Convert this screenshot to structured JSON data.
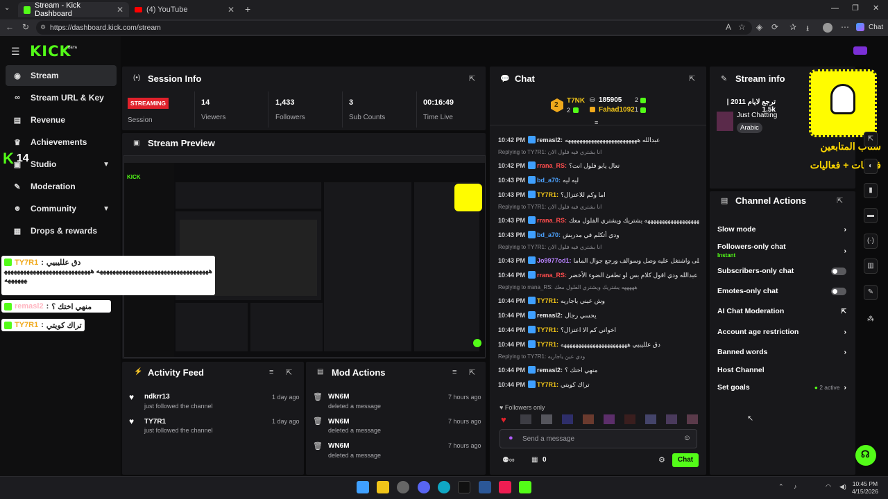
{
  "browser": {
    "tabs": [
      {
        "label": "Stream - Kick Dashboard"
      },
      {
        "label": "(4) YouTube"
      }
    ],
    "url": "https://dashboard.kick.com/stream",
    "chat_btn": "Chat"
  },
  "brand": {
    "logo": "KICK",
    "beta": "BETA",
    "accent": "#53fc18"
  },
  "sidebar": {
    "items": [
      {
        "label": "Stream",
        "icon": "broadcast-icon"
      },
      {
        "label": "Stream URL & Key",
        "icon": "link-icon"
      },
      {
        "label": "Revenue",
        "icon": "cash-icon"
      },
      {
        "label": "Achievements",
        "icon": "trophy-icon"
      },
      {
        "label": "Studio",
        "icon": "camera-icon"
      },
      {
        "label": "Moderation",
        "icon": "wrench-icon"
      },
      {
        "label": "Community",
        "icon": "people-icon"
      },
      {
        "label": "Drops & rewards",
        "icon": "gift-icon"
      }
    ],
    "overlay_count": "14"
  },
  "session": {
    "title": "Session Info",
    "status": "STREAMING",
    "status_label": "Session",
    "stats": [
      {
        "value": "14",
        "label": "Viewers"
      },
      {
        "value": "1,433",
        "label": "Followers"
      },
      {
        "value": "3",
        "label": "Sub Counts"
      },
      {
        "value": "00:16:49",
        "label": "Time Live"
      }
    ]
  },
  "preview": {
    "title": "Stream Preview"
  },
  "activity": {
    "title": "Activity Feed",
    "items": [
      {
        "name": "ndkrr13",
        "sub": "just followed the channel",
        "time": "1 day ago"
      },
      {
        "name": "TY7R1",
        "sub": "just followed the channel",
        "time": "1 day ago"
      }
    ]
  },
  "mod": {
    "title": "Mod Actions",
    "items": [
      {
        "name": "WN6M",
        "sub": "deleted a message",
        "time": "7 hours ago"
      },
      {
        "name": "WN6M",
        "sub": "deleted a message",
        "time": "7 hours ago"
      },
      {
        "name": "WN6M",
        "sub": "deleted a message",
        "time": "7 hours ago"
      }
    ]
  },
  "chat": {
    "title": "Chat",
    "top_gifter": "T7NK",
    "gifter_count": "2",
    "top_points": "185905",
    "points_user": "Fahad1092",
    "points_sub_a": "2",
    "points_sub_b": "1",
    "lines": [
      {
        "time": "10:42 PM",
        "user": "remasl2:",
        "color": "#e9e9ea",
        "text": "عبدالله هههههههههههههههههههههههههه"
      },
      {
        "reply": "Replying to TY7R1: انا بشتري فيه فلول الان"
      },
      {
        "time": "10:42 PM",
        "user": "rrana_RS:",
        "color": "#ff4d4d",
        "text": "تعال يابو فلول انت؟"
      },
      {
        "time": "10:43 PM",
        "user": "bd_a70:",
        "color": "#4da3ff",
        "text": "ليه ليه"
      },
      {
        "time": "10:43 PM",
        "user": "TY7R1:",
        "color": "#f0c419",
        "text": "اما وكم للاعتزال؟"
      },
      {
        "reply": "Replying to TY7R1: انا بشتري فيه فلول الان"
      },
      {
        "time": "10:43 PM",
        "user": "rrana_RS:",
        "color": "#ff4d4d",
        "text": "ههههههههههههههههههههههههه يشتريك ويشتري الفلول معك"
      },
      {
        "time": "10:43 PM",
        "user": "bd_a70:",
        "color": "#4da3ff",
        "text": "ودي أتكلم في مدريش"
      },
      {
        "reply": "Replying to TY7R1: انا بشتري فيه فلول الان"
      },
      {
        "time": "10:43 PM",
        "user": "Jo9977od1:",
        "color": "#b983ff",
        "text": "تعال يابو فلول انا ابي احطم على واشتغل عليه وصل وسوالف ورجع جوال الماما"
      },
      {
        "time": "10:44 PM",
        "user": "rrana_RS:",
        "color": "#ff4d4d",
        "text": "عبدالله ودي اقول كلام بس لو تطفئ الضوء الأخضر"
      },
      {
        "reply": "Replying to rrana_RS: هههههه يشتريك ويشتري الفلول معك"
      },
      {
        "time": "10:44 PM",
        "user": "TY7R1:",
        "color": "#f0c419",
        "text": "وش عيني ياجاريه"
      },
      {
        "time": "10:44 PM",
        "user": "remasl2:",
        "color": "#e9e9ea",
        "text": "يحسي رجال"
      },
      {
        "time": "10:44 PM",
        "user": "TY7R1:",
        "color": "#f0c419",
        "text": "اخواني كم الا اعتزال؟"
      },
      {
        "time": "10:44 PM",
        "user": "TY7R1:",
        "color": "#f0c419",
        "text": "دق علليبيي هههههههههههههههههههههههه"
      },
      {
        "reply": "Replying to TY7R1: ودي عين ياجاريه"
      },
      {
        "time": "10:44 PM",
        "user": "remasl2:",
        "color": "#e9e9ea",
        "text": "منهي اختك ؟"
      },
      {
        "time": "10:44 PM",
        "user": "TY7R1:",
        "color": "#f0c419",
        "text": "تراك كويتي"
      }
    ],
    "followers_only": "Followers only",
    "placeholder": "Send a message",
    "points": "0",
    "send": "Chat"
  },
  "streaminfo": {
    "title": "Stream info",
    "stream_title": "ترجع لايام 2011 | 1.5k",
    "category": "Just Chatting",
    "language": "Arabic",
    "snap_text_1": "سناب المتابعين",
    "snap_text_2": "فلوقات + فعاليات"
  },
  "actions": {
    "title": "Channel Actions",
    "items": [
      {
        "label": "Slow mode",
        "ctrl": "chevron"
      },
      {
        "label": "Followers-only chat",
        "sub": "Instant",
        "ctrl": "chevron"
      },
      {
        "label": "Subscribers-only chat",
        "ctrl": "toggle"
      },
      {
        "label": "Emotes-only chat",
        "ctrl": "toggle"
      },
      {
        "label": "AI Chat Moderation",
        "ctrl": "external"
      },
      {
        "label": "Account age restriction",
        "ctrl": "chevron"
      },
      {
        "label": "Banned words",
        "ctrl": "chevron"
      },
      {
        "label": "Host Channel",
        "ctrl": "none"
      },
      {
        "label": "Set goals",
        "ctrl": "chevron",
        "extra": "2 active"
      }
    ]
  },
  "overlay": {
    "msgs": [
      {
        "user": "TY7R1",
        "text": "دق علليبيي",
        "body": "هههههههههههههههههههههههههههههههههههه ههههههههههههههههههههههههههههههههههه"
      },
      {
        "user": "remasl2",
        "text": "منهي اختك ؟"
      },
      {
        "user": "TY7R1",
        "text": "تراك كويتي"
      }
    ]
  },
  "clock": {
    "time": "10:45 PM",
    "date": "4/15/2026"
  }
}
